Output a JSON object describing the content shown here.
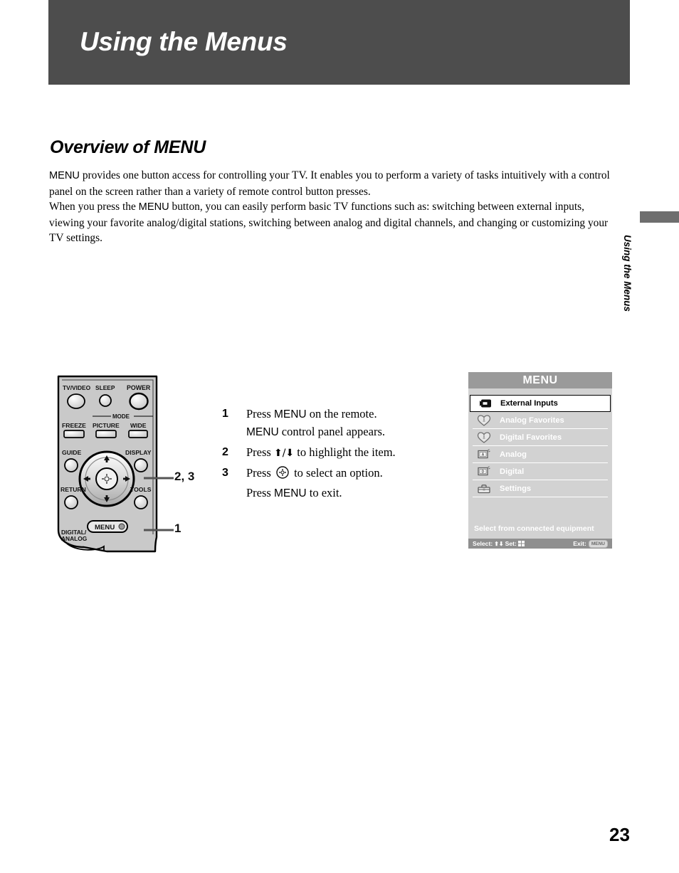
{
  "chapter": {
    "title": "Using the Menus",
    "bar_color": "#4d4d4d"
  },
  "section": {
    "heading": "Overview of MENU",
    "paragraph_1_prefix": "MENU",
    "paragraph_1": " provides one button access for controlling your TV. It enables you to perform a variety of tasks intuitively with a control panel on the screen rather than a variety of remote control button presses.",
    "paragraph_2_a": "When you press the ",
    "paragraph_2_key": "MENU",
    "paragraph_2_b": " button, you can easily perform basic TV functions such as: switching between external inputs, viewing your favorite analog/digital stations, switching between analog and digital channels, and changing or customizing your TV settings."
  },
  "thumb_tab": {
    "label": "Using the Menus",
    "block_color": "#6e6e6e"
  },
  "remote": {
    "buttons": {
      "tv_video": "TV/VIDEO",
      "sleep": "SLEEP",
      "power": "POWER",
      "mode": "MODE",
      "freeze": "FREEZE",
      "picture": "PICTURE",
      "wide": "WIDE",
      "guide": "GUIDE",
      "display": "DISPLAY",
      "return": "RETURN",
      "tools": "TOOLS",
      "menu": "MENU",
      "digital_analog_line1": "DIGITAL/",
      "digital_analog_line2": "ANALOG"
    },
    "callouts": {
      "dpad": "2, 3",
      "menu": "1"
    }
  },
  "steps": [
    {
      "number": "1",
      "line1_a": "Press ",
      "line1_key": "MENU",
      "line1_b": " on the remote.",
      "line2_key": "MENU",
      "line2_b": " control panel appears."
    },
    {
      "number": "2",
      "line1_a": "Press ",
      "line1_arrows": "⬆/⬇",
      "line1_b": " to highlight the item."
    },
    {
      "number": "3",
      "line1_a": "Press ",
      "line1_icon": "select-center-icon",
      "line1_b": " to select an option.",
      "line2_a": "Press ",
      "line2_key": "MENU",
      "line2_b": " to exit."
    }
  ],
  "osd": {
    "title": "MENU",
    "title_bg": "#9a9a9a",
    "panel_bg": "#d2d2d2",
    "items": [
      {
        "label": "External Inputs",
        "icon": "external-input-icon",
        "selected": true
      },
      {
        "label": "Analog Favorites",
        "icon": "heart-icon",
        "selected": false
      },
      {
        "label": "Digital Favorites",
        "icon": "heart-icon",
        "selected": false
      },
      {
        "label": "Analog",
        "icon": "analog-tv-icon",
        "selected": false
      },
      {
        "label": "Digital",
        "icon": "digital-tv-icon",
        "selected": false
      },
      {
        "label": "Settings",
        "icon": "toolbox-icon",
        "selected": false
      }
    ],
    "hint": "Select from connected equipment",
    "status_bar": {
      "select_label": "Select:",
      "select_arrows": "⬆⬇",
      "set_label": "Set:",
      "exit_label": "Exit:",
      "exit_key": "MENU"
    }
  },
  "page_number": "23"
}
